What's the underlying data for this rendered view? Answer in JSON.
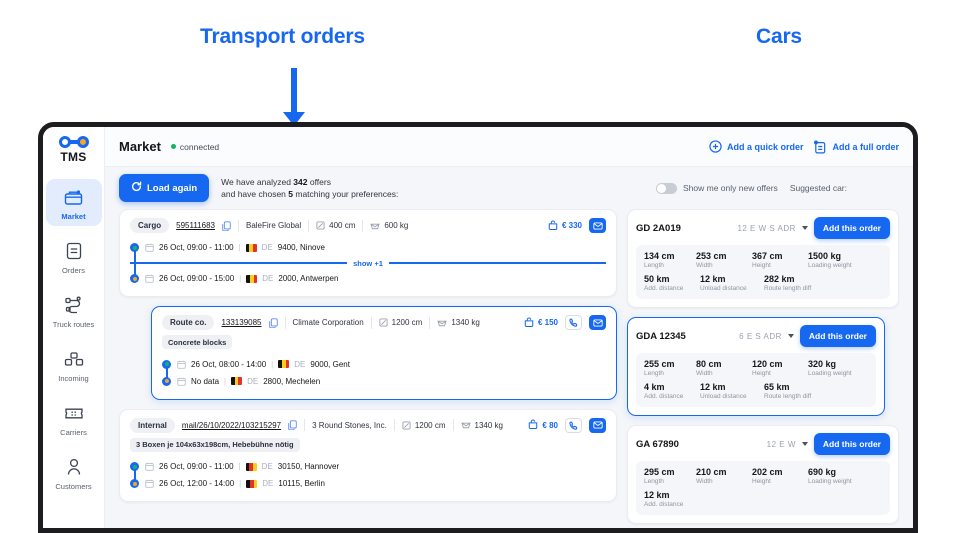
{
  "annotations": {
    "left_label": "Transport orders",
    "right_label": "Cars",
    "color": "#1768f0"
  },
  "sidebar": {
    "logo_text": "TMS",
    "items": [
      {
        "label": "Market",
        "icon": "market-icon",
        "active": true
      },
      {
        "label": "Orders",
        "icon": "orders-icon",
        "active": false
      },
      {
        "label": "Truck routes",
        "icon": "truck-routes-icon",
        "active": false
      },
      {
        "label": "Incoming",
        "icon": "incoming-icon",
        "active": false
      },
      {
        "label": "Carriers",
        "icon": "carriers-icon",
        "active": false
      },
      {
        "label": "Customers",
        "icon": "customers-icon",
        "active": false
      }
    ]
  },
  "topbar": {
    "title": "Market",
    "status": "connected",
    "quick_order": "Add a quick order",
    "full_order": "Add a full order"
  },
  "subbar": {
    "load_again": "Load again",
    "analyzed_line1_pre": "We have analyzed ",
    "analyzed_count": "342",
    "analyzed_line1_post": " offers",
    "analyzed_line2_pre": "and have chosen ",
    "chosen_count": "5",
    "analyzed_line2_post": " matching your preferences:",
    "toggle_label": "Show me only new offers",
    "toggle_on": false,
    "suggested_car_label": "Suggested car:"
  },
  "orders": [
    {
      "type": "Cargo",
      "ref": "595111683",
      "description": null,
      "company": "BaleFire Global",
      "length": "400 cm",
      "weight": "600 kg",
      "price": "€ 330",
      "has_phone": false,
      "has_mail": true,
      "selected": false,
      "shifted": false,
      "show_more": "show +1",
      "stops": [
        {
          "time": "26 Oct, 09:00 - 11:00",
          "country": "DE",
          "place": "9400, Ninove",
          "flag": "be",
          "dot": "#16b364"
        },
        {
          "time": "26 Oct, 09:00 - 15:00",
          "country": "DE",
          "place": "2000, Antwerpen",
          "flag": "be",
          "dot": "#f5a623"
        }
      ]
    },
    {
      "type": "Route co.",
      "ref": "133139085",
      "description": "Concrete blocks",
      "company": "Climate Corporation",
      "length": "1200 cm",
      "weight": "1340 kg",
      "price": "€ 150",
      "has_phone": true,
      "has_mail": true,
      "selected": true,
      "shifted": true,
      "show_more": null,
      "stops": [
        {
          "time": "26 Oct, 08:00 - 14:00",
          "country": "DE",
          "place": "9000, Gent",
          "flag": "be",
          "dot": "#16b364"
        },
        {
          "time": "No data",
          "country": "DE",
          "place": "2800, Mechelen",
          "flag": "be",
          "dot": "#f5a623"
        }
      ]
    },
    {
      "type": "Internal",
      "ref": "mail/26/10/2022/103215297",
      "description": "3 Boxen je 104x63x198cm, Hebebühne nötig",
      "company": "3 Round Stones, Inc.",
      "length": "1200 cm",
      "weight": "1340 kg",
      "price": "€ 80",
      "has_phone": true,
      "has_mail": true,
      "selected": false,
      "shifted": false,
      "show_more": null,
      "stops": [
        {
          "time": "26 Oct, 09:00 - 11:00",
          "country": "DE",
          "place": "30150, Hannover",
          "flag": "de",
          "dot": "#16b364"
        },
        {
          "time": "26 Oct, 12:00 - 14:00",
          "country": "DE",
          "place": "10115, Berlin",
          "flag": "de",
          "dot": "#f5a623"
        }
      ]
    }
  ],
  "cars": [
    {
      "plate": "GD 2A019",
      "tags": "12 E W S ADR",
      "add_button": "Add this order",
      "selected": false,
      "specs_row1": [
        {
          "value": "134 cm",
          "label": "Length"
        },
        {
          "value": "253 cm",
          "label": "Width"
        },
        {
          "value": "367 cm",
          "label": "Height"
        },
        {
          "value": "1500 kg",
          "label": "Loading weight"
        }
      ],
      "specs_row2": [
        {
          "value": "50 km",
          "label": "Add. distance"
        },
        {
          "value": "12 km",
          "label": "Unload distance"
        },
        {
          "value": "282 km",
          "label": "Route length diff"
        }
      ]
    },
    {
      "plate": "GDA 12345",
      "tags": "6 E S ADR",
      "add_button": "Add this order",
      "selected": true,
      "specs_row1": [
        {
          "value": "255 cm",
          "label": "Length"
        },
        {
          "value": "80 cm",
          "label": "Width"
        },
        {
          "value": "120 cm",
          "label": "Height"
        },
        {
          "value": "320 kg",
          "label": "Loading weight"
        }
      ],
      "specs_row2": [
        {
          "value": "4 km",
          "label": "Add. distance"
        },
        {
          "value": "12 km",
          "label": "Unload distance"
        },
        {
          "value": "65 km",
          "label": "Route length diff"
        }
      ]
    },
    {
      "plate": "GA 67890",
      "tags": "12 E W",
      "add_button": "Add this order",
      "selected": false,
      "specs_row1": [
        {
          "value": "295 cm",
          "label": "Length"
        },
        {
          "value": "210 cm",
          "label": "Width"
        },
        {
          "value": "202 cm",
          "label": "Height"
        },
        {
          "value": "690 kg",
          "label": "Loading weight"
        }
      ],
      "specs_row2": [
        {
          "value": "12 km",
          "label": "Add. distance"
        }
      ]
    }
  ]
}
